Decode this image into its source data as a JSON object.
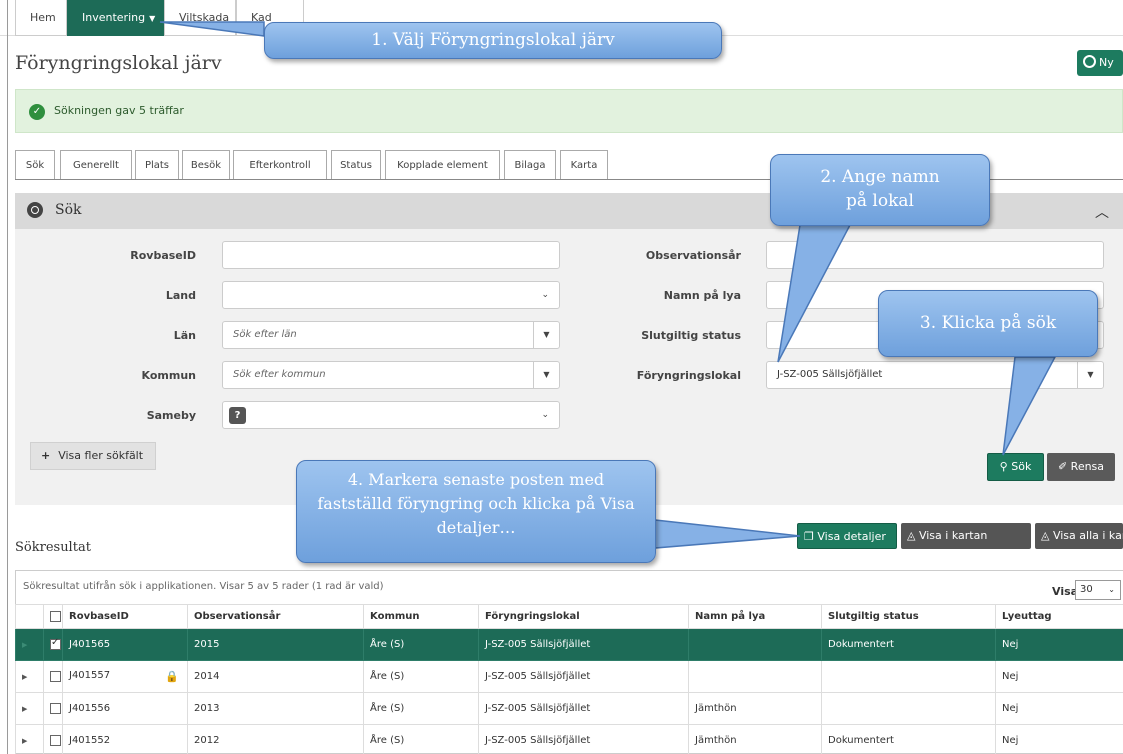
{
  "nav": {
    "tabs": [
      "Hem",
      "Inventering",
      "Viltskada",
      "Kad"
    ]
  },
  "page_title": "Föryngringslokal järv",
  "ny_button": "Ny",
  "alert": "Sökningen gav 5 träffar",
  "tabs": [
    "Sök",
    "Generellt",
    "Plats",
    "Besök",
    "Efterkontroll",
    "Status",
    "Kopplade element",
    "Bilaga",
    "Karta"
  ],
  "search_panel": {
    "title": "Sök",
    "labels": {
      "rovbase": "RovbaseID",
      "land": "Land",
      "lan": "Län",
      "kommun": "Kommun",
      "sameby": "Sameby",
      "obsar": "Observationsår",
      "namn": "Namn på lya",
      "status": "Slutgiltig status",
      "lokal": "Föryngringslokal"
    },
    "placeholders": {
      "lan": "Sök efter län",
      "kommun": "Sök efter kommun"
    },
    "values": {
      "lokal": "J-SZ-005 Sällsjöfjället"
    },
    "more_fields": "Visa fler sökfält",
    "search_btn": "Sök",
    "clear_btn": "Rensa"
  },
  "results": {
    "title": "Sökresultat",
    "buttons": {
      "details": "Visa detaljer",
      "map": "Visa i kartan",
      "map_all": "Visa alla i kartan"
    },
    "info": "Sökresultat utifrån sök i applikationen. Visar 5 av 5 rader (1 rad är vald)",
    "visa_label": "Visa",
    "visa_value": "30",
    "columns": [
      "RovbaseID",
      "Observationsår",
      "Kommun",
      "Föryngringslokal",
      "Namn på lya",
      "Slutgiltig status",
      "Lyeuttag"
    ],
    "rows": [
      {
        "id": "J401565",
        "year": "2015",
        "kommun": "Åre (S)",
        "lokal": "J-SZ-005 Sällsjöfjället",
        "namn": "",
        "status": "Dokumentert",
        "lye": "Nej"
      },
      {
        "id": "J401557",
        "year": "2014",
        "kommun": "Åre (S)",
        "lokal": "J-SZ-005 Sällsjöfjället",
        "namn": "",
        "status": "",
        "lye": "Nej"
      },
      {
        "id": "J401556",
        "year": "2013",
        "kommun": "Åre (S)",
        "lokal": "J-SZ-005 Sällsjöfjället",
        "namn": "Jämthön",
        "status": "",
        "lye": "Nej"
      },
      {
        "id": "J401552",
        "year": "2012",
        "kommun": "Åre (S)",
        "lokal": "J-SZ-005 Sällsjöfjället",
        "namn": "Jämthön",
        "status": "Dokumentert",
        "lye": "Nej"
      }
    ]
  },
  "callouts": {
    "c1": "1. Välj Föryngringslokal järv",
    "c2": "2. Ange namn på lokal",
    "c3": "3. Klicka på sök",
    "c4": "4. Markera senaste posten med fastställd föryngring och klicka på Visa detaljer…"
  }
}
